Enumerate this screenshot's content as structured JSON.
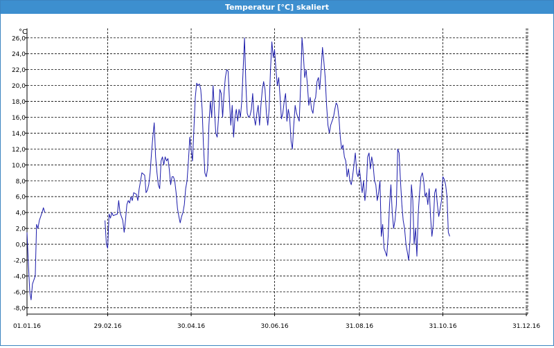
{
  "window": {
    "title": "Temperatur [°C] skaliert"
  },
  "chart_data": {
    "type": "line",
    "title": "Temperatur [°C] skaliert",
    "ylabel": "°C",
    "xlabel": "",
    "grid": true,
    "legend": "none",
    "line_color": "#1a1aaa",
    "x_tick_labels": [
      "01.01.16",
      "29.02.16",
      "30.04.16",
      "30.06.16",
      "31.08.16",
      "31.10.16",
      "31.12.16"
    ],
    "x_tick_days": [
      0,
      59,
      120,
      181,
      243,
      304,
      365
    ],
    "ylim": [
      -8.8,
      27.2
    ],
    "y_ticks": [
      -8.0,
      -6.0,
      -4.0,
      -2.0,
      0.0,
      2.0,
      4.0,
      6.0,
      8.0,
      10.0,
      12.0,
      14.0,
      16.0,
      18.0,
      20.0,
      22.0,
      24.0,
      26.0
    ],
    "y_tick_labels": [
      "-8,0",
      "-6,0",
      "-4,0",
      "-2,0",
      "0,0",
      "2,0",
      "4,0",
      "6,0",
      "8,0",
      "10,0",
      "12,0",
      "14,0",
      "16,0",
      "18,0",
      "20,0",
      "22,0",
      "24,0",
      "26,0"
    ],
    "series": [
      {
        "points": [
          [
            0,
            1.5
          ],
          [
            1,
            -2.5
          ],
          [
            2,
            -6.0
          ],
          [
            3,
            -7.0
          ],
          [
            4,
            -5.0
          ],
          [
            5,
            -4.5
          ],
          [
            6,
            -4.0
          ],
          [
            7,
            2.5
          ],
          [
            8,
            2.0
          ],
          [
            9,
            3.0
          ],
          [
            10,
            3.5
          ],
          [
            11,
            4.0
          ],
          [
            12,
            4.6
          ],
          [
            13,
            4.0
          ],
          null,
          [
            57,
            3.0
          ],
          [
            58,
            0.0
          ],
          [
            59,
            -0.5
          ],
          [
            60,
            3.8
          ],
          [
            61,
            3.3
          ],
          [
            62,
            4.0
          ],
          [
            63,
            3.6
          ],
          [
            66,
            3.8
          ],
          [
            67,
            5.5
          ],
          [
            68,
            4.0
          ],
          [
            69,
            3.5
          ],
          [
            70,
            3.0
          ],
          [
            71,
            1.5
          ],
          [
            72,
            3.0
          ],
          [
            73,
            5.0
          ],
          [
            74,
            5.5
          ],
          [
            75,
            5.2
          ],
          [
            76,
            6.0
          ],
          [
            77,
            5.5
          ],
          [
            78,
            6.5
          ],
          [
            80,
            6.3
          ],
          [
            81,
            5.5
          ],
          [
            82,
            7.0
          ],
          [
            83,
            8.0
          ],
          [
            84,
            9.0
          ],
          [
            86,
            8.7
          ],
          [
            87,
            6.5
          ],
          [
            88,
            6.8
          ],
          [
            89,
            7.5
          ],
          [
            90,
            9.0
          ],
          [
            91,
            11.5
          ],
          [
            92,
            13.5
          ],
          [
            93,
            15.3
          ],
          [
            94,
            11.0
          ],
          [
            95,
            9.0
          ],
          [
            96,
            7.5
          ],
          [
            97,
            7.0
          ],
          [
            98,
            10.5
          ],
          [
            99,
            11.0
          ],
          [
            100,
            10.0
          ],
          [
            101,
            11.0
          ],
          [
            102,
            10.5
          ],
          [
            103,
            10.8
          ],
          [
            104,
            9.5
          ],
          [
            105,
            7.5
          ],
          [
            106,
            8.5
          ],
          [
            107,
            8.5
          ],
          [
            108,
            8.0
          ],
          [
            109,
            6.5
          ],
          [
            110,
            4.5
          ],
          [
            111,
            3.5
          ],
          [
            112,
            2.7
          ],
          [
            113,
            3.5
          ],
          [
            114,
            4.0
          ],
          [
            115,
            5.0
          ],
          [
            116,
            7.0
          ],
          [
            117,
            8.0
          ],
          [
            118,
            10.5
          ],
          [
            119,
            13.5
          ],
          [
            120,
            12.0
          ],
          [
            121,
            10.5
          ],
          [
            122,
            14.5
          ],
          [
            123,
            18.5
          ],
          [
            124,
            20.3
          ],
          [
            125,
            20.0
          ],
          [
            126,
            20.2
          ],
          [
            127,
            19.5
          ],
          [
            128,
            17.0
          ],
          [
            129,
            12.5
          ],
          [
            130,
            9.0
          ],
          [
            131,
            8.5
          ],
          [
            132,
            9.5
          ],
          [
            133,
            15.0
          ],
          [
            134,
            18.0
          ],
          [
            135,
            16.0
          ],
          [
            136,
            20.0
          ],
          [
            137,
            17.0
          ],
          [
            138,
            14.0
          ],
          [
            139,
            13.5
          ],
          [
            140,
            16.0
          ],
          [
            141,
            19.5
          ],
          [
            142,
            19.0
          ],
          [
            143,
            16.0
          ],
          [
            144,
            19.0
          ],
          [
            145,
            21.0
          ],
          [
            146,
            22.0
          ],
          [
            147,
            21.8
          ],
          [
            148,
            18.0
          ],
          [
            149,
            15.0
          ],
          [
            150,
            17.5
          ],
          [
            151,
            13.5
          ],
          [
            152,
            16.0
          ],
          [
            153,
            17.0
          ],
          [
            154,
            15.5
          ],
          [
            155,
            17.0
          ],
          [
            156,
            16.0
          ],
          [
            157,
            18.0
          ],
          [
            158,
            22.0
          ],
          [
            159,
            26.0
          ],
          [
            160,
            20.0
          ],
          [
            161,
            16.5
          ],
          [
            162,
            16.0
          ],
          [
            163,
            16.2
          ],
          [
            164,
            17.0
          ],
          [
            165,
            19.0
          ],
          [
            166,
            16.0
          ],
          [
            167,
            15.0
          ],
          [
            168,
            16.5
          ],
          [
            169,
            17.5
          ],
          [
            170,
            15.0
          ],
          [
            171,
            17.5
          ],
          [
            172,
            19.5
          ],
          [
            173,
            20.5
          ],
          [
            174,
            19.5
          ],
          [
            175,
            16.5
          ],
          [
            176,
            15.0
          ],
          [
            177,
            17.0
          ],
          [
            178,
            22.0
          ],
          [
            179,
            25.5
          ],
          [
            180,
            23.5
          ],
          [
            181,
            24.5
          ],
          [
            182,
            22.0
          ],
          [
            183,
            20.0
          ],
          [
            184,
            21.0
          ],
          [
            185,
            18.5
          ],
          [
            186,
            15.8
          ],
          [
            187,
            16.5
          ],
          [
            188,
            18.0
          ],
          [
            189,
            19.0
          ],
          [
            190,
            15.5
          ],
          [
            191,
            17.0
          ],
          [
            192,
            16.0
          ],
          [
            193,
            13.0
          ],
          [
            194,
            12.0
          ],
          [
            195,
            15.0
          ],
          [
            196,
            17.5
          ],
          [
            197,
            16.5
          ],
          [
            198,
            16.0
          ],
          [
            199,
            15.5
          ],
          [
            200,
            20.0
          ],
          [
            201,
            26.0
          ],
          [
            202,
            24.0
          ],
          [
            203,
            21.0
          ],
          [
            204,
            22.0
          ],
          [
            205,
            20.0
          ],
          [
            206,
            17.5
          ],
          [
            207,
            18.5
          ],
          [
            208,
            17.0
          ],
          [
            209,
            16.5
          ],
          [
            210,
            18.0
          ],
          [
            211,
            18.5
          ],
          [
            212,
            20.5
          ],
          [
            213,
            21.0
          ],
          [
            214,
            19.5
          ],
          [
            215,
            22.0
          ],
          [
            216,
            24.8
          ],
          [
            217,
            23.0
          ],
          [
            218,
            21.0
          ],
          [
            219,
            17.5
          ],
          [
            220,
            15.0
          ],
          [
            221,
            14.0
          ],
          [
            222,
            15.0
          ],
          [
            223,
            15.5
          ],
          [
            224,
            16.0
          ],
          [
            225,
            17.0
          ],
          [
            226,
            17.8
          ],
          [
            227,
            17.5
          ],
          [
            228,
            16.0
          ],
          [
            229,
            13.5
          ],
          [
            230,
            12.0
          ],
          [
            231,
            12.5
          ],
          [
            232,
            11.0
          ],
          [
            233,
            10.5
          ],
          [
            234,
            8.5
          ],
          [
            235,
            9.5
          ],
          [
            236,
            8.0
          ],
          [
            237,
            7.5
          ],
          [
            238,
            8.5
          ],
          [
            239,
            10.0
          ],
          [
            240,
            11.5
          ],
          [
            241,
            9.0
          ],
          [
            242,
            8.5
          ],
          [
            243,
            9.5
          ],
          [
            244,
            8.0
          ],
          [
            245,
            6.5
          ],
          [
            246,
            8.0
          ],
          [
            247,
            5.5
          ],
          [
            248,
            7.0
          ],
          [
            249,
            11.0
          ],
          [
            250,
            11.5
          ],
          [
            251,
            9.5
          ],
          [
            252,
            11.0
          ],
          [
            253,
            10.0
          ],
          [
            254,
            8.0
          ],
          [
            255,
            7.5
          ],
          [
            256,
            5.5
          ],
          [
            257,
            6.5
          ],
          [
            258,
            8.0
          ],
          [
            259,
            1.0
          ],
          [
            260,
            2.5
          ],
          [
            261,
            -0.5
          ],
          [
            262,
            -1.0
          ],
          [
            263,
            -1.5
          ],
          [
            264,
            1.0
          ],
          [
            265,
            5.0
          ],
          [
            266,
            7.5
          ],
          [
            267,
            4.0
          ],
          [
            268,
            2.0
          ],
          [
            269,
            3.0
          ],
          [
            270,
            5.0
          ],
          [
            271,
            12.0
          ],
          [
            272,
            11.5
          ],
          [
            273,
            8.0
          ],
          [
            274,
            5.0
          ],
          [
            275,
            3.0
          ],
          [
            276,
            2.0
          ],
          [
            277,
            0.0
          ],
          [
            278,
            -1.0
          ],
          [
            279,
            -2.0
          ],
          [
            280,
            0.5
          ],
          [
            281,
            7.5
          ],
          [
            282,
            5.5
          ],
          [
            283,
            0.0
          ],
          [
            284,
            2.0
          ],
          [
            285,
            -1.5
          ],
          [
            286,
            4.0
          ],
          [
            287,
            6.5
          ],
          [
            288,
            8.5
          ],
          [
            289,
            9.0
          ],
          [
            290,
            8.0
          ],
          [
            291,
            6.0
          ],
          [
            292,
            6.5
          ],
          [
            293,
            5.0
          ],
          [
            294,
            7.0
          ],
          [
            295,
            3.5
          ],
          [
            296,
            1.0
          ],
          [
            297,
            2.5
          ],
          [
            298,
            6.5
          ],
          [
            299,
            7.0
          ],
          [
            300,
            5.0
          ],
          [
            301,
            3.5
          ],
          [
            302,
            4.5
          ],
          [
            303,
            5.5
          ],
          [
            304,
            8.5
          ],
          [
            305,
            8.2
          ],
          [
            306,
            7.5
          ],
          [
            307,
            6.0
          ],
          [
            308,
            1.5
          ],
          [
            309,
            1.0
          ]
        ]
      }
    ]
  }
}
